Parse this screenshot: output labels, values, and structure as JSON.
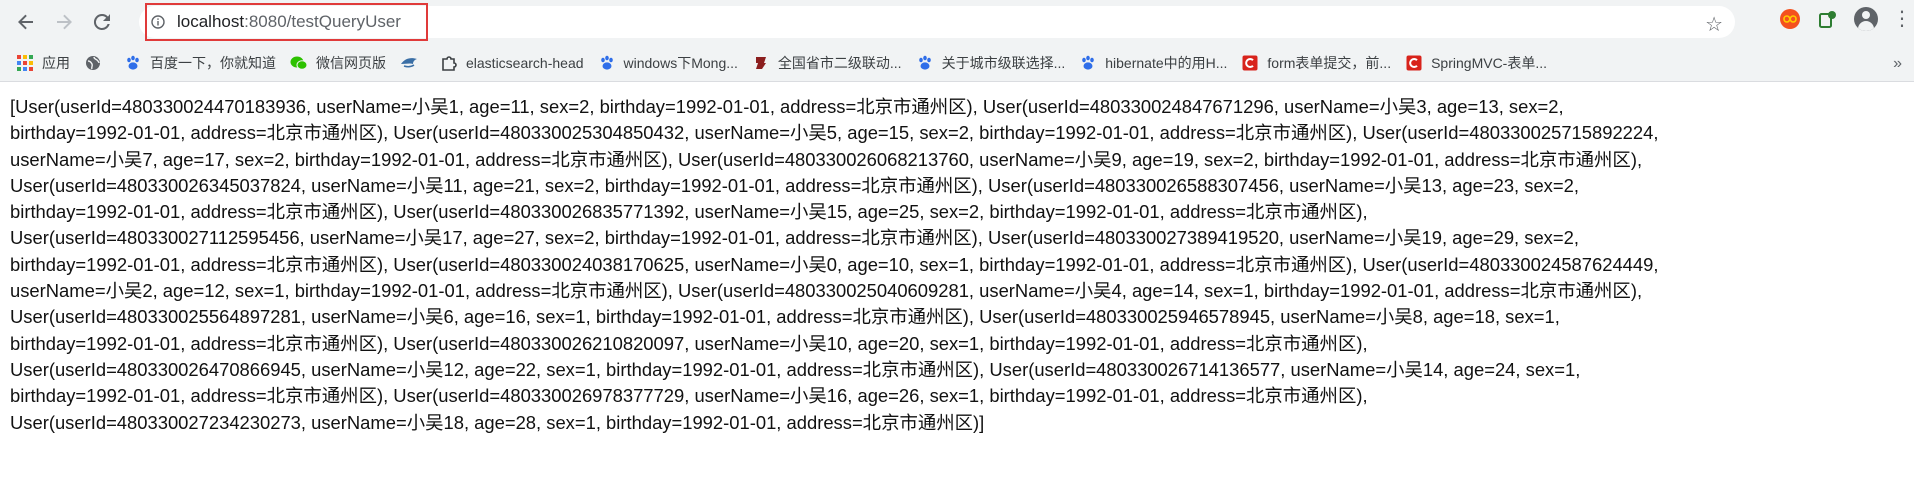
{
  "browser": {
    "url_host": "localhost",
    "url_path": ":8080/testQueryUser"
  },
  "bookmarks": [
    {
      "label": "应用",
      "icon": "apps-grid-icon",
      "color": "#4285f4"
    },
    {
      "label": "",
      "icon": "globe-icon",
      "color": "#5f6368"
    },
    {
      "label": "百度一下，你就知道",
      "icon": "baidu-paw-icon",
      "color": "#2f6ee9"
    },
    {
      "label": "微信网页版",
      "icon": "wechat-icon",
      "color": "#2dc100"
    },
    {
      "label": "",
      "icon": "bird-icon",
      "color": "#3a6ea5"
    },
    {
      "label": "elasticsearch-head",
      "icon": "puzzle-icon",
      "color": "#3c4043"
    },
    {
      "label": "windows下Mong...",
      "icon": "baidu-paw-icon",
      "color": "#2f6ee9"
    },
    {
      "label": "全国省市二级联动...",
      "icon": "jr-icon",
      "color": "#8b1e1e"
    },
    {
      "label": "关于城市级联选择...",
      "icon": "baidu-paw-icon",
      "color": "#2f6ee9"
    },
    {
      "label": "hibernate中的用H...",
      "icon": "baidu-paw-icon",
      "color": "#2f6ee9"
    },
    {
      "label": "form表单提交，前...",
      "icon": "csdn-icon",
      "color": "#d8231b"
    },
    {
      "label": "SpringMVC-表单...",
      "icon": "csdn-icon",
      "color": "#d8231b"
    }
  ],
  "content": {
    "lines": [
      "[User(userId=480330024470183936, userName=小吴1, age=11, sex=2, birthday=1992-01-01, address=北京市通州区), User(userId=480330024847671296, userName=小吴3, age=13, sex=2,",
      "birthday=1992-01-01, address=北京市通州区), User(userId=480330025304850432, userName=小吴5, age=15, sex=2, birthday=1992-01-01, address=北京市通州区), User(userId=480330025715892224,",
      "userName=小吴7, age=17, sex=2, birthday=1992-01-01, address=北京市通州区), User(userId=480330026068213760, userName=小吴9, age=19, sex=2, birthday=1992-01-01, address=北京市通州区),",
      "User(userId=480330026345037824, userName=小吴11, age=21, sex=2, birthday=1992-01-01, address=北京市通州区), User(userId=480330026588307456, userName=小吴13, age=23, sex=2,",
      "birthday=1992-01-01, address=北京市通州区), User(userId=480330026835771392, userName=小吴15, age=25, sex=2, birthday=1992-01-01, address=北京市通州区),",
      "User(userId=480330027112595456, userName=小吴17, age=27, sex=2, birthday=1992-01-01, address=北京市通州区), User(userId=480330027389419520, userName=小吴19, age=29, sex=2,",
      "birthday=1992-01-01, address=北京市通州区), User(userId=480330024038170625, userName=小吴0, age=10, sex=1, birthday=1992-01-01, address=北京市通州区), User(userId=480330024587624449,",
      "userName=小吴2, age=12, sex=1, birthday=1992-01-01, address=北京市通州区), User(userId=480330025040609281, userName=小吴4, age=14, sex=1, birthday=1992-01-01, address=北京市通州区),",
      "User(userId=480330025564897281, userName=小吴6, age=16, sex=1, birthday=1992-01-01, address=北京市通州区), User(userId=480330025946578945, userName=小吴8, age=18, sex=1,",
      "birthday=1992-01-01, address=北京市通州区), User(userId=480330026210820097, userName=小吴10, age=20, sex=1, birthday=1992-01-01, address=北京市通州区),",
      "User(userId=480330026470866945, userName=小吴12, age=22, sex=1, birthday=1992-01-01, address=北京市通州区), User(userId=480330026714136577, userName=小吴14, age=24, sex=1,",
      "birthday=1992-01-01, address=北京市通州区), User(userId=480330026978377729, userName=小吴16, age=26, sex=1, birthday=1992-01-01, address=北京市通州区),",
      "User(userId=480330027234230273, userName=小吴18, age=28, sex=1, birthday=1992-01-01, address=北京市通州区)]"
    ]
  },
  "colors": {
    "toolbar_bg": "#f1f3f4",
    "highlight_border": "#e03a3a",
    "text": "#111111"
  }
}
